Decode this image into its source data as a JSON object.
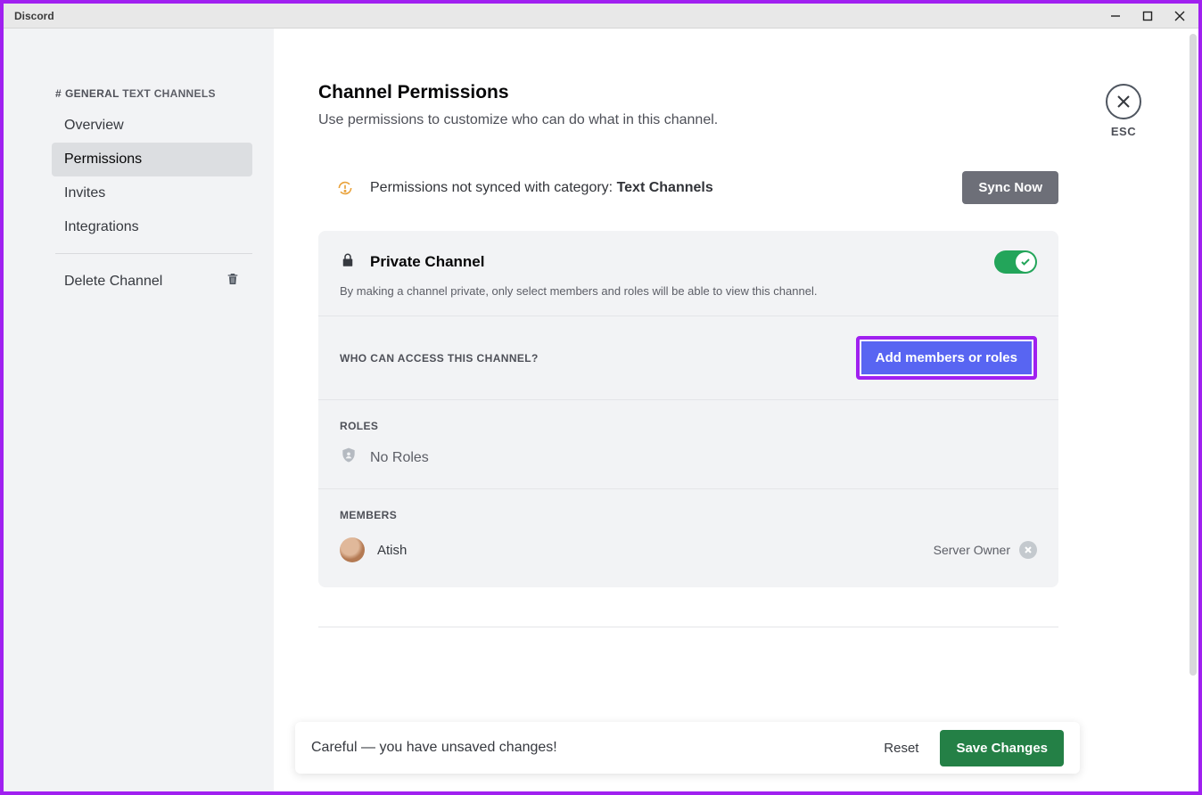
{
  "window": {
    "title": "Discord"
  },
  "sidebar": {
    "hash": "#",
    "channel": "GENERAL",
    "section": "TEXT CHANNELS",
    "items": [
      "Overview",
      "Permissions",
      "Invites",
      "Integrations"
    ],
    "active_index": 1,
    "delete_label": "Delete Channel"
  },
  "page": {
    "title": "Channel Permissions",
    "subtitle": "Use permissions to customize who can do what in this channel.",
    "close": "ESC"
  },
  "sync": {
    "text": "Permissions not synced with category: ",
    "category": "Text Channels",
    "button": "Sync Now"
  },
  "private": {
    "title": "Private Channel",
    "desc": "By making a channel private, only select members and roles will be able to view this channel.",
    "enabled": true
  },
  "access": {
    "label": "WHO CAN ACCESS THIS CHANNEL?",
    "button": "Add members or roles"
  },
  "roles": {
    "label": "ROLES",
    "empty": "No Roles"
  },
  "members": {
    "label": "MEMBERS",
    "list": [
      {
        "name": "Atish",
        "role": "Server Owner"
      }
    ]
  },
  "savebar": {
    "message": "Careful — you have unsaved changes!",
    "reset": "Reset",
    "save": "Save Changes"
  }
}
